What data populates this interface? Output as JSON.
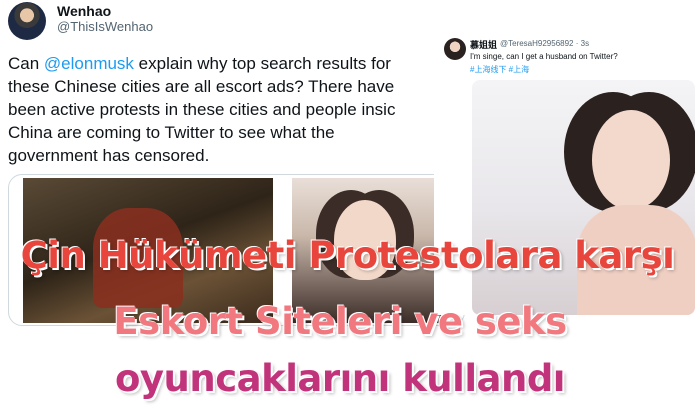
{
  "left_tweet": {
    "author_name": "Wenhao",
    "author_handle": "@ThisIsWenhao",
    "text_lines": [
      {
        "prefix": "Can ",
        "mention": "@elonmusk",
        "suffix": " explain why top search results for"
      },
      {
        "prefix": "these Chinese cities are all escort ads? There have",
        "mention": "",
        "suffix": ""
      },
      {
        "prefix": "been active protests in these cities and people insic",
        "mention": "",
        "suffix": ""
      },
      {
        "prefix": "China are coming to Twitter to see what the",
        "mention": "",
        "suffix": ""
      },
      {
        "prefix": "government has censored.",
        "mention": "",
        "suffix": ""
      }
    ]
  },
  "right_tweet": {
    "author_name": "慕姐姐",
    "author_handle": "@TeresaH92956892 · 3s",
    "text": "I'm singe, can I get a husband on Twitter?",
    "hashtags": "#上海线下 #上海"
  },
  "headline": {
    "line1": "Çin Hükümeti Protestolara karşı",
    "line2": "Eskort Siteleri ve seks",
    "line3": "oyuncaklarını kullandı"
  }
}
